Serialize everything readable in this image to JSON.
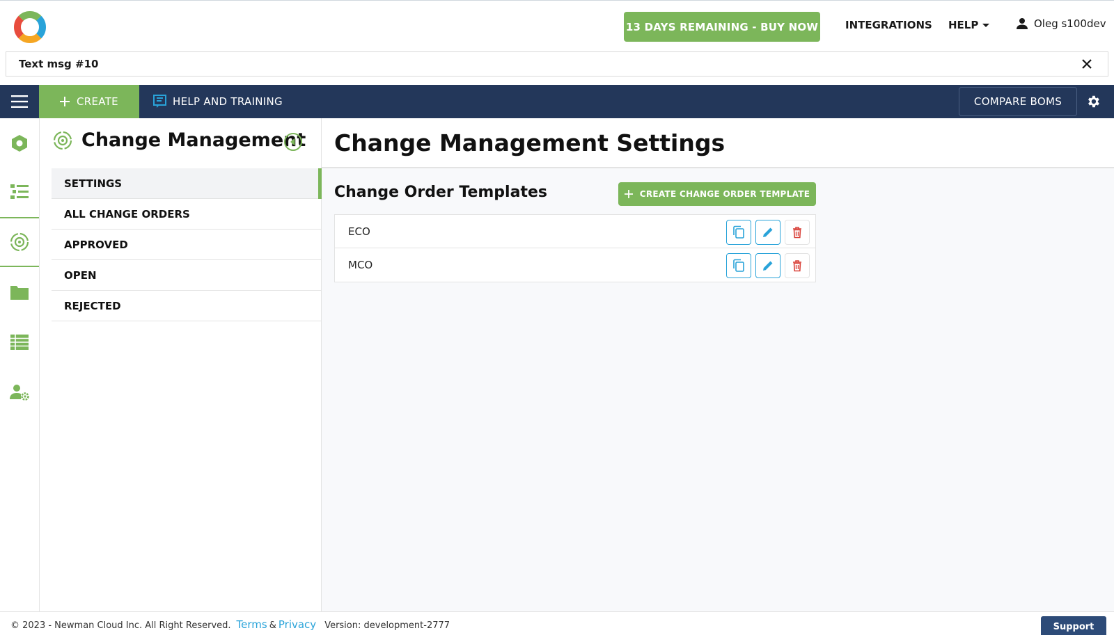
{
  "header": {
    "trial_button": "13 DAYS REMAINING - BUY NOW",
    "integrations": "INTEGRATIONS",
    "help": "HELP",
    "user_name": "Oleg s100dev"
  },
  "message_bar": {
    "text": "Text msg #10"
  },
  "navbar": {
    "create": "CREATE",
    "help_training": "HELP AND TRAINING",
    "compare_boms": "COMPARE BOMS"
  },
  "rail": {
    "items": [
      "components-icon",
      "products-icon",
      "change-management-icon",
      "documents-icon",
      "lists-icon",
      "user-settings-icon"
    ],
    "active_index": 2
  },
  "section": {
    "title": "Change Management",
    "menu": [
      {
        "label": "SETTINGS",
        "active": true
      },
      {
        "label": "ALL CHANGE ORDERS",
        "active": false
      },
      {
        "label": "APPROVED",
        "active": false
      },
      {
        "label": "OPEN",
        "active": false
      },
      {
        "label": "REJECTED",
        "active": false
      }
    ]
  },
  "main": {
    "title": "Change Management Settings",
    "templates_title": "Change Order Templates",
    "create_template_button": "CREATE CHANGE ORDER TEMPLATE",
    "templates": [
      {
        "name": "ECO"
      },
      {
        "name": "MCO"
      }
    ]
  },
  "footer": {
    "copyright": "© 2023 - Newman Cloud Inc. All Right Reserved.",
    "terms": "Terms",
    "amp": "&",
    "privacy": "Privacy",
    "version": "Version: development-2777",
    "support": "Support"
  },
  "colors": {
    "brand_green": "#7cb65a",
    "nav_blue": "#23375a",
    "link_blue": "#29a3d9",
    "delete_red": "#d9423a"
  }
}
